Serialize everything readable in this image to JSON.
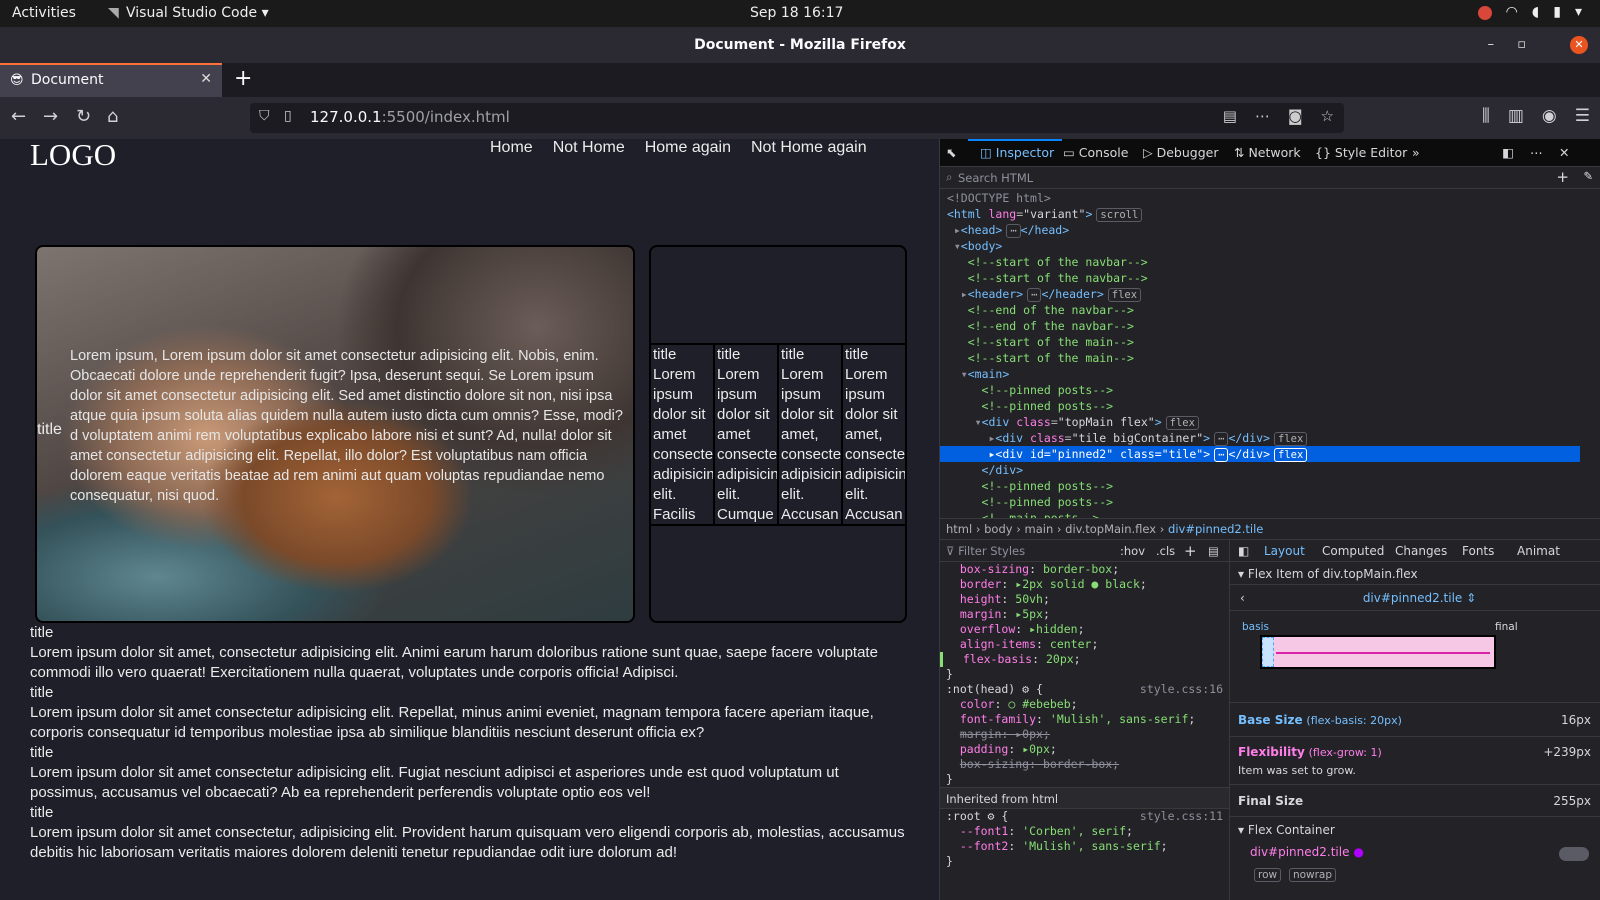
{
  "os": {
    "activities": "Activities",
    "app_name": "Visual Studio Code",
    "clock": "Sep 18  16:17"
  },
  "window": {
    "title": "Document - Mozilla Firefox"
  },
  "tabs": [
    {
      "favicon": "😎",
      "title": "Document"
    }
  ],
  "url": {
    "host": "127.0.0.1",
    "rest": ":5500/index.html"
  },
  "site": {
    "logo": "LOGO",
    "nav": [
      "Home",
      "Not Home",
      "Home again",
      "Not Home again"
    ],
    "big_tile": {
      "title": "title",
      "text": "Lorem ipsum, Lorem ipsum dolor sit amet consectetur adipisicing elit. Nobis, enim. Obcaecati dolore unde reprehenderit fugit? Ipsa, deserunt sequi. Se Lorem ipsum dolor sit amet consectetur adipisicing elit. Sed amet distinctio dolore sit non, nisi ipsa atque quia ipsum soluta alias quidem nulla autem iusto dicta cum omnis? Esse, modi? d voluptatem animi rem voluptatibus explicabo labore nisi et sunt? Ad, nulla! dolor sit amet consectetur adipisicing elit. Repellat, illo dolor? Est voluptatibus nam officia dolorem eaque veritatis beatae ad rem animi aut quam voluptas repudiandae nemo consequatur, nisi quod."
    },
    "pinned_cols": [
      {
        "title": "title",
        "text": "Lorem ipsum dolor sit amet consectetur adipisicing elit. Facilis"
      },
      {
        "title": "title",
        "text": "Lorem ipsum dolor sit amet consectetur adipisicing elit. Cumque"
      },
      {
        "title": "title",
        "text": "Lorem ipsum dolor sit amet, consectetur adipisicing elit. Accusan"
      },
      {
        "title": "title",
        "text": "Lorem ipsum dolor sit amet, consectetur adipisicing elit. Accusan"
      }
    ],
    "posts": [
      {
        "title": "title",
        "text": "Lorem ipsum dolor sit amet, consectetur adipisicing elit. Animi earum harum doloribus ratione sunt quae, saepe facere voluptate commodi illo vero quaerat! Exercitationem nulla quaerat, voluptates unde corporis officia! Adipisci."
      },
      {
        "title": "title",
        "text": "Lorem ipsum dolor sit amet consectetur adipisicing elit. Repellat, minus animi eveniet, magnam tempora facere aperiam itaque, corporis consequatur id temporibus molestiae ipsa ab similique blanditiis nesciunt deserunt officia ex?"
      },
      {
        "title": "title",
        "text": "Lorem ipsum dolor sit amet consectetur adipisicing elit. Fugiat nesciunt adipisci et asperiores unde est quod voluptatum ut possimus, accusamus vel obcaecati? Ab ea reprehenderit perferendis voluptate optio eos vel!"
      },
      {
        "title": "title",
        "text": "Lorem ipsum dolor sit amet consectetur, adipisicing elit. Provident harum quisquam vero eligendi corporis ab, molestias, accusamus debitis hic laboriosam veritatis maiores dolorem deleniti tenetur repudiandae odit iure dolorum ad!"
      }
    ]
  },
  "devtools": {
    "tabs": [
      "Inspector",
      "Console",
      "Debugger",
      "Network",
      "Style Editor"
    ],
    "search_placeholder": "Search HTML",
    "breadcrumbs": [
      "html",
      "body",
      "main",
      "div.topMain.flex",
      "div#pinned2.tile"
    ],
    "filter_placeholder": "Filter Styles",
    "hov": ":hov",
    "cls": ".cls",
    "layout_tabs": [
      "Layout",
      "Computed",
      "Changes",
      "Fonts",
      "Animat"
    ],
    "flex_item_header": "Flex Item of div.topMain.flex",
    "selector": "div#pinned2.tile",
    "basis_label": "basis",
    "final_label": "final",
    "base_size_label": "Base Size",
    "base_size_note": "(flex-basis: 20px)",
    "base_size_value": "16px",
    "flexibility_label": "Flexibility",
    "flexibility_note": "(flex-grow: 1)",
    "flexibility_value": "+239px",
    "grow_note": "Item was set to grow.",
    "final_size_label": "Final Size",
    "final_size_value": "255px",
    "flex_container_header": "Flex Container",
    "container_selector": "div#pinned2.tile",
    "row_label": "row",
    "nowrap_label": "nowrap",
    "inherited_label": "Inherited from html",
    "style_src_1": "style.css:16",
    "style_src_2": "style.css:11"
  }
}
